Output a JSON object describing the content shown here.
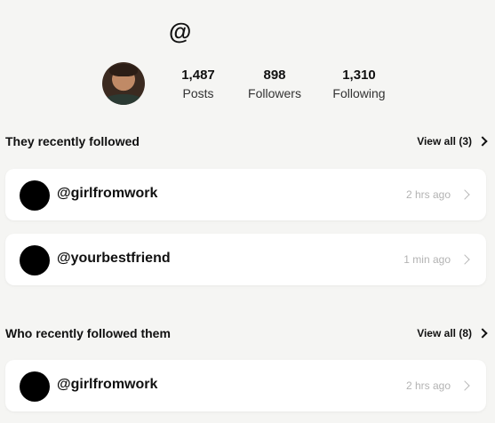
{
  "profile": {
    "handle": "@",
    "stats": [
      {
        "value": "1,487",
        "label": "Posts"
      },
      {
        "value": "898",
        "label": "Followers"
      },
      {
        "value": "1,310",
        "label": "Following"
      }
    ]
  },
  "recently_followed": {
    "title": "They recently followed",
    "view_all": "View all (3)",
    "items": [
      {
        "username": "@girlfromwork",
        "time": "2 hrs ago"
      },
      {
        "username": "@yourbestfriend",
        "time": "1 min ago"
      }
    ]
  },
  "recently_followed_them": {
    "title": "Who recently followed them",
    "view_all": "View all (8)",
    "items": [
      {
        "username": "@girlfromwork",
        "time": "2 hrs ago"
      }
    ]
  }
}
